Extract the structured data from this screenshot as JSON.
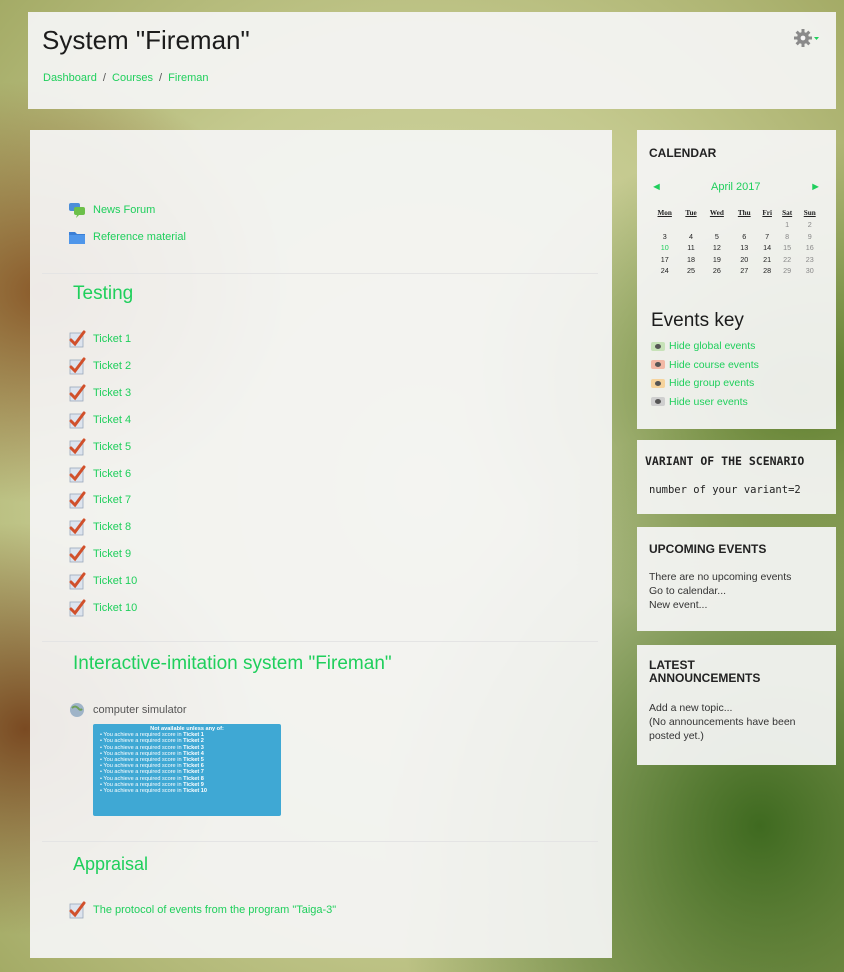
{
  "header": {
    "title": "System \"Fireman\"",
    "breadcrumb": [
      "Dashboard",
      "Courses",
      "Fireman"
    ],
    "breadcrumb_sep": "/"
  },
  "main": {
    "top_activities": [
      {
        "label": "News Forum",
        "icon": "forum-icon"
      },
      {
        "label": "Reference material",
        "icon": "folder-icon"
      }
    ],
    "sections": [
      {
        "title": "Testing",
        "activities": [
          "Ticket 1",
          "Ticket 2",
          "Ticket 3",
          "Ticket 4",
          "Ticket 5",
          "Ticket 6",
          "Ticket 7",
          "Ticket 8",
          "Ticket 9",
          "Ticket 10",
          "Ticket 10"
        ]
      },
      {
        "title": "Interactive-imitation system \"Fireman\"",
        "activity": "computer simulator",
        "restriction": {
          "heading": "Not available unless any of:",
          "prefix": "You achieve a required score in",
          "items": [
            "Ticket 1",
            "Ticket 2",
            "Ticket 3",
            "Ticket 4",
            "Ticket 5",
            "Ticket 6",
            "Ticket 7",
            "Ticket 8",
            "Ticket 9",
            "Ticket 10"
          ]
        }
      },
      {
        "title": "Appraisal",
        "activity": "The protocol of events from the program \"Taiga-3\""
      }
    ]
  },
  "calendar": {
    "title": "CALENDAR",
    "month": "April 2017",
    "prev": "◄",
    "next": "►",
    "days": [
      "Mon",
      "Tue",
      "Wed",
      "Thu",
      "Fri",
      "Sat",
      "Sun"
    ],
    "weeks": [
      [
        "",
        "",
        "",
        "",
        "",
        "1",
        "2"
      ],
      [
        "3",
        "4",
        "5",
        "6",
        "7",
        "8",
        "9"
      ],
      [
        "10",
        "11",
        "12",
        "13",
        "14",
        "15",
        "16"
      ],
      [
        "17",
        "18",
        "19",
        "20",
        "21",
        "22",
        "23"
      ],
      [
        "24",
        "25",
        "26",
        "27",
        "28",
        "29",
        "30"
      ]
    ],
    "today": "10",
    "events_key_title": "Events key",
    "events_key": [
      {
        "label": "Hide global events",
        "color": "#c7e2b8"
      },
      {
        "label": "Hide course events",
        "color": "#f2b8a6"
      },
      {
        "label": "Hide group events",
        "color": "#f6d39c"
      },
      {
        "label": "Hide user events",
        "color": "#cfcfcf"
      }
    ]
  },
  "variant": {
    "title": "VARIANT OF THE SCENARIO",
    "text": "number of your variant=2"
  },
  "upcoming": {
    "title": "UPCOMING EVENTS",
    "text": "There are no upcoming events",
    "link1": "Go to calendar...",
    "link2": "New event..."
  },
  "latest": {
    "title": "LATEST ANNOUNCEMENTS",
    "link": "Add a new topic...",
    "text": "(No announcements have been posted yet.)"
  }
}
